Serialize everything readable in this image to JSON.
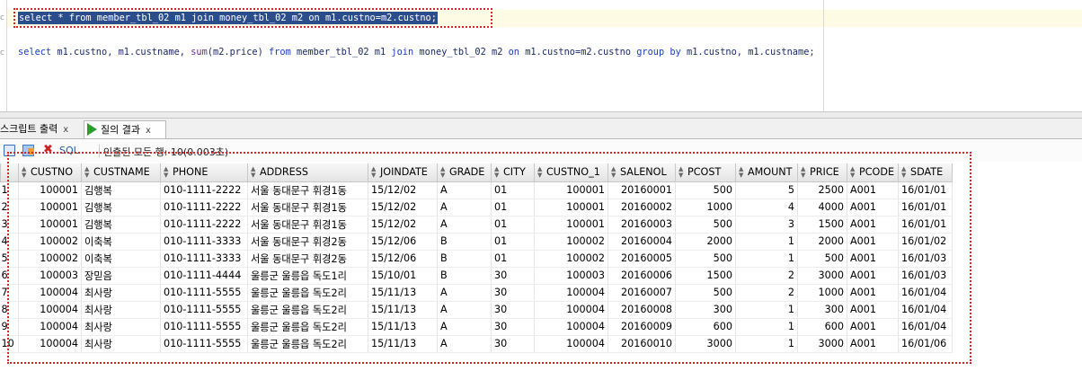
{
  "editor": {
    "line1": "select * from member_tbl_02 m1 join money_tbl_02 m2 on m1.custno=m2.custno;",
    "line2": {
      "parts": [
        {
          "t": "select",
          "k": "kw"
        },
        {
          "t": " m1.custno, m1.custname, ",
          "k": ""
        },
        {
          "t": "sum",
          "k": "fn"
        },
        {
          "t": "(m2.price) ",
          "k": ""
        },
        {
          "t": "from",
          "k": "kw"
        },
        {
          "t": " member_tbl_02 m1 ",
          "k": ""
        },
        {
          "t": "join",
          "k": "kw"
        },
        {
          "t": " money_tbl_02 m2 ",
          "k": ""
        },
        {
          "t": "on",
          "k": "kw"
        },
        {
          "t": " m1.custno=m2.custno ",
          "k": ""
        },
        {
          "t": "group by",
          "k": "kw"
        },
        {
          "t": " m1.custno, m1.custname;",
          "k": ""
        }
      ]
    },
    "gutter_marks": [
      "c",
      "c"
    ]
  },
  "tabs": {
    "script_output": "스크립트 출력",
    "query_result": "질의 결과",
    "close": "x"
  },
  "toolbar": {
    "sql_label": "SQL",
    "fetch_info": "인출된 모든 행: 10(0.003초)"
  },
  "grid": {
    "columns": [
      "CUSTNO",
      "CUSTNAME",
      "PHONE",
      "ADDRESS",
      "JOINDATE",
      "GRADE",
      "CITY",
      "CUSTNO_1",
      "SALENOL",
      "PCOST",
      "AMOUNT",
      "PRICE",
      "PCODE",
      "SDATE"
    ],
    "rows": [
      [
        "1",
        "100001",
        "김행복",
        "010-1111-2222",
        "서울 동대문구 휘경1동",
        "15/12/02",
        "A",
        "01",
        "100001",
        "20160001",
        "500",
        "5",
        "2500",
        "A001",
        "16/01/01"
      ],
      [
        "2",
        "100001",
        "김행복",
        "010-1111-2222",
        "서울 동대문구 휘경1동",
        "15/12/02",
        "A",
        "01",
        "100001",
        "20160002",
        "1000",
        "4",
        "4000",
        "A001",
        "16/01/01"
      ],
      [
        "3",
        "100001",
        "김행복",
        "010-1111-2222",
        "서울 동대문구 휘경1동",
        "15/12/02",
        "A",
        "01",
        "100001",
        "20160003",
        "500",
        "3",
        "1500",
        "A001",
        "16/01/01"
      ],
      [
        "4",
        "100002",
        "이축복",
        "010-1111-3333",
        "서울 동대문구 휘경2동",
        "15/12/06",
        "B",
        "01",
        "100002",
        "20160004",
        "2000",
        "1",
        "2000",
        "A001",
        "16/01/02"
      ],
      [
        "5",
        "100002",
        "이축복",
        "010-1111-3333",
        "서울 동대문구 휘경2동",
        "15/12/06",
        "B",
        "01",
        "100002",
        "20160005",
        "500",
        "1",
        "500",
        "A001",
        "16/01/03"
      ],
      [
        "6",
        "100003",
        "장믿음",
        "010-1111-4444",
        "울릉군 울릉읍 독도1리",
        "15/10/01",
        "B",
        "30",
        "100003",
        "20160006",
        "1500",
        "2",
        "3000",
        "A001",
        "16/01/03"
      ],
      [
        "7",
        "100004",
        "최사랑",
        "010-1111-5555",
        "울릉군 울릉읍 독도2리",
        "15/11/13",
        "A",
        "30",
        "100004",
        "20160007",
        "500",
        "2",
        "1000",
        "A001",
        "16/01/04"
      ],
      [
        "8",
        "100004",
        "최사랑",
        "010-1111-5555",
        "울릉군 울릉읍 독도2리",
        "15/11/13",
        "A",
        "30",
        "100004",
        "20160008",
        "300",
        "1",
        "300",
        "A001",
        "16/01/04"
      ],
      [
        "9",
        "100004",
        "최사랑",
        "010-1111-5555",
        "울릉군 울릉읍 독도2리",
        "15/11/13",
        "A",
        "30",
        "100004",
        "20160009",
        "600",
        "1",
        "600",
        "A001",
        "16/01/04"
      ],
      [
        "10",
        "100004",
        "최사랑",
        "010-1111-5555",
        "울릉군 울릉읍 독도2리",
        "15/11/13",
        "A",
        "30",
        "100004",
        "20160010",
        "3000",
        "1",
        "3000",
        "A001",
        "16/01/06"
      ]
    ]
  },
  "colors": {
    "highlight_bg": "#2b4d8c",
    "annotation_border": "#d2262b",
    "keyword": "#1a35d8"
  }
}
